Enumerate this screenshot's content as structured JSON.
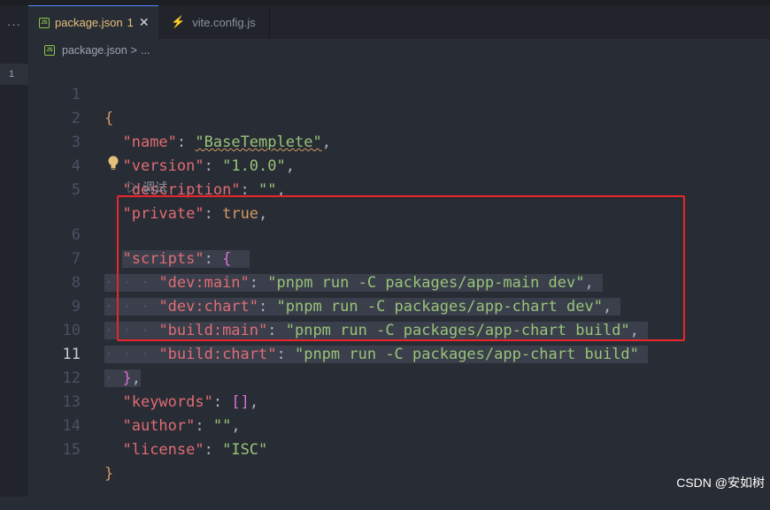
{
  "activity": {
    "dots": "···",
    "badge": "1"
  },
  "tabs": [
    {
      "label": "package.json",
      "badge": "1",
      "close": "✕",
      "icon": "json-file-icon"
    },
    {
      "label": "vite.config.js",
      "icon": "lightning-icon"
    }
  ],
  "breadcrumb": {
    "file": "package.json",
    "separator": ">",
    "more": "..."
  },
  "editor": {
    "current_line": 11,
    "codelens": "▷ 调试",
    "lines": [
      {
        "n": "1"
      },
      {
        "n": "2"
      },
      {
        "n": "3"
      },
      {
        "n": "4"
      },
      {
        "n": "5"
      },
      {
        "n": "6"
      },
      {
        "n": "7"
      },
      {
        "n": "8"
      },
      {
        "n": "9"
      },
      {
        "n": "10"
      },
      {
        "n": "11"
      },
      {
        "n": "12"
      },
      {
        "n": "13"
      },
      {
        "n": "14"
      },
      {
        "n": "15"
      }
    ],
    "tokens": {
      "l1_open": "{",
      "l2_key": "\"name\"",
      "l2_val": "\"BaseTemplete\"",
      "l3_key": "\"version\"",
      "l3_val": "\"1.0.0\"",
      "l4_key": "\"description\"",
      "l4_val": "\"\"",
      "l5_key": "\"private\"",
      "l5_val": "true",
      "l6_key": "\"scripts\"",
      "l6_open": "{",
      "l7_key": "\"dev:main\"",
      "l7_val": "\"pnpm run -C packages/app-main dev\"",
      "l8_key": "\"dev:chart\"",
      "l8_val": "\"pnpm run -C packages/app-chart dev\"",
      "l9_key": "\"build:main\"",
      "l9_val": "\"pnpm run -C packages/app-chart build\"",
      "l10_key": "\"build:chart\"",
      "l10_val": "\"pnpm run -C packages/app-chart build\"",
      "l11_close": "}",
      "l12_key": "\"keywords\"",
      "l12_val": "[]",
      "l13_key": "\"author\"",
      "l13_val": "\"\"",
      "l14_key": "\"license\"",
      "l14_val": "\"ISC\"",
      "l15_close": "}",
      "colon": ": ",
      "comma": ","
    }
  },
  "watermark": "CSDN @安如树",
  "colors": {
    "key": "#e06c75",
    "string": "#98c379",
    "boolean": "#d19a66",
    "bracket": "#da70d6",
    "highlight_box": "#e8262b"
  }
}
